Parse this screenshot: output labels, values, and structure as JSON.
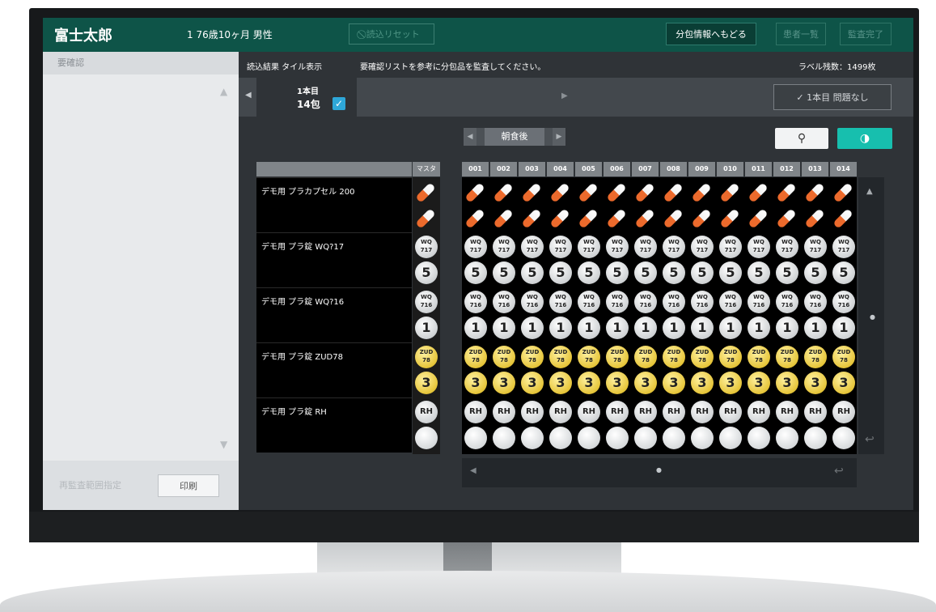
{
  "header": {
    "patient_name": "富士太郎",
    "patient_info": "1  76歳10ヶ月  男性",
    "reset_label": "⃠ 読込リセット",
    "back_label": "分包情報へもどる",
    "patient_list_label": "患者一覧",
    "audit_done_label": "監査完了"
  },
  "left_panel": {
    "title": "要確認",
    "range_label": "再監査範囲指定",
    "print_label": "印刷"
  },
  "topbar": {
    "title": "読込結果 タイル表示",
    "message": "要確認リストを参考に分包品を監査してください。",
    "remaining": "ラベル残数：1499枚"
  },
  "tab": {
    "day_label": "1本目",
    "pack_count": "14包",
    "ok_label": "✓  1本目 問題なし"
  },
  "timing": {
    "label": "朝食後"
  },
  "table": {
    "master_header": "マスタ",
    "columns": [
      "001",
      "002",
      "003",
      "004",
      "005",
      "006",
      "007",
      "008",
      "009",
      "010",
      "011",
      "012",
      "013",
      "014"
    ],
    "drugs": [
      {
        "name": "デモ用  プラカプセル 200",
        "type": "capsule"
      },
      {
        "name": "デモ用  プラ錠 WQ?17",
        "type": "tablet",
        "code_top": "WQ",
        "code_bottom": "717",
        "number": "5"
      },
      {
        "name": "デモ用  プラ錠 WQ?16",
        "type": "tablet",
        "code_top": "WQ",
        "code_bottom": "716",
        "number": "1"
      },
      {
        "name": "デモ用  プラ錠 ZUD78",
        "type": "yellow",
        "code_top": "ZUD",
        "code_bottom": "78",
        "number": "3"
      },
      {
        "name": "デモ用  プラ錠 RH",
        "type": "rh",
        "code_top": "RH"
      }
    ]
  },
  "colors": {
    "header_bg": "#0e5448",
    "accent_teal": "#17bfae",
    "check_blue": "#2ea7d8",
    "capsule_orange": "#ec6a2c"
  }
}
